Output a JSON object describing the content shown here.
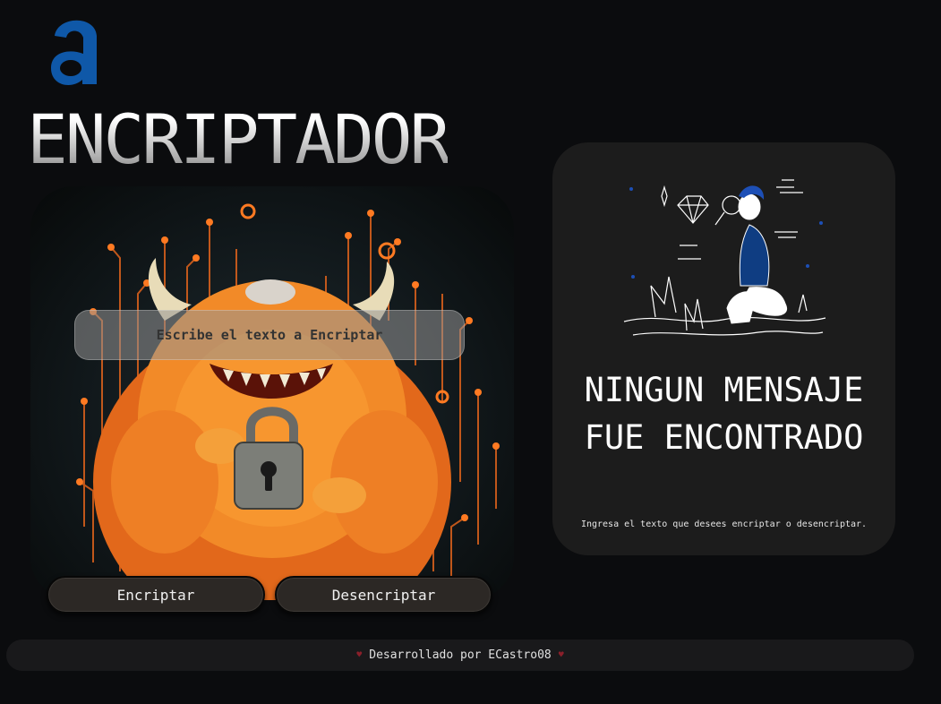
{
  "app": {
    "title": "ENCRIPTADOR",
    "logo_letter": "a"
  },
  "input": {
    "placeholder": "Escribe el texto a Encriptar",
    "value": ""
  },
  "actions": {
    "encrypt_label": "Encriptar",
    "decrypt_label": "Desencriptar"
  },
  "result": {
    "title": "NINGUN MENSAJE FUE ENCONTRADO",
    "description": "Ingresa el texto que desees encriptar o desencriptar."
  },
  "footer": {
    "text": "Desarrollado por ECastro08",
    "heart_icon": "heart-icon"
  },
  "colors": {
    "background": "#0b0c0e",
    "panel": "#1c1c1c",
    "logo_blue": "#0f58a8",
    "monster_orange": "#f07a1c",
    "button_bg": "#2c2825"
  }
}
